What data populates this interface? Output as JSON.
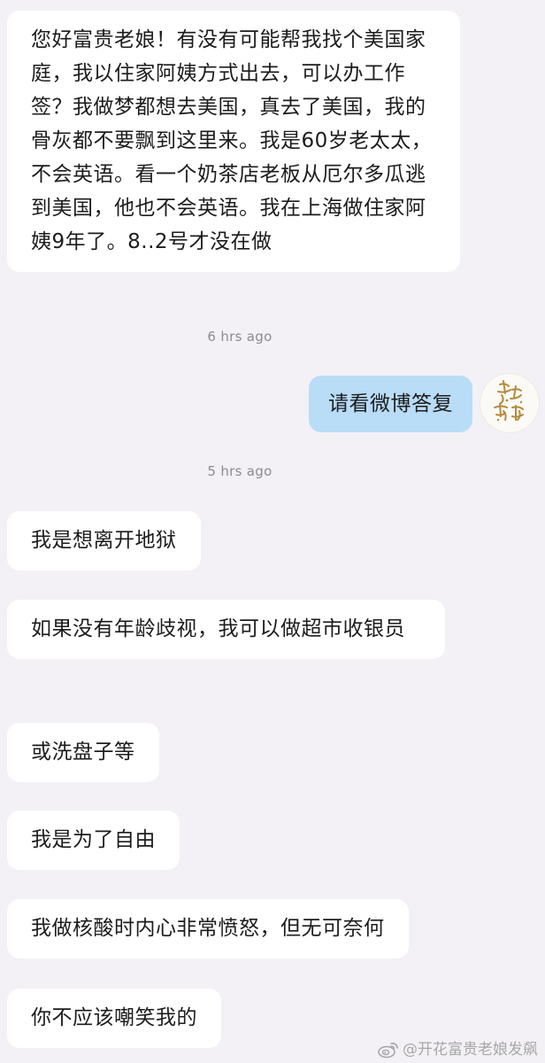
{
  "conversation": {
    "messages": [
      {
        "direction": "incoming",
        "text": "您好富贵老娘！有没有可能帮我找个美国家庭，我以住家阿姨方式出去，可以办工作签？我做梦都想去美国，真去了美国，我的骨灰都不要飘到这里来。我是60岁老太太，不会英语。看一个奶茶店老板从厄尔多瓜逃到美国，他也不会英语。我在上海做住家阿姨9年了。8..2号才没在做"
      },
      {
        "direction": "outgoing",
        "text": "请看微博答复"
      },
      {
        "direction": "incoming",
        "text": "我是想离开地狱"
      },
      {
        "direction": "incoming",
        "text": "如果没有年龄歧视，我可以做超市收银员"
      },
      {
        "direction": "incoming",
        "text": "或洗盘子等"
      },
      {
        "direction": "incoming",
        "text": "我是为了自由"
      },
      {
        "direction": "incoming",
        "text": "我做核酸时内心非常愤怒，但无可奈何"
      },
      {
        "direction": "incoming",
        "text": "你不应该嘲笑我的"
      }
    ],
    "timestamps": [
      "6 hrs ago",
      "5 hrs ago"
    ]
  },
  "avatar": {
    "calligraphy_text": "花开富贵",
    "icon": "calligraphy-avatar-icon"
  },
  "watermark": {
    "text": "@开花富贵老娘发飙",
    "icon": "weibo-logo-icon"
  },
  "colors": {
    "background": "#f3f1f6",
    "incoming_bubble": "#ffffff",
    "outgoing_bubble": "#b9dcf7",
    "timestamp_text": "#8d8b91"
  }
}
